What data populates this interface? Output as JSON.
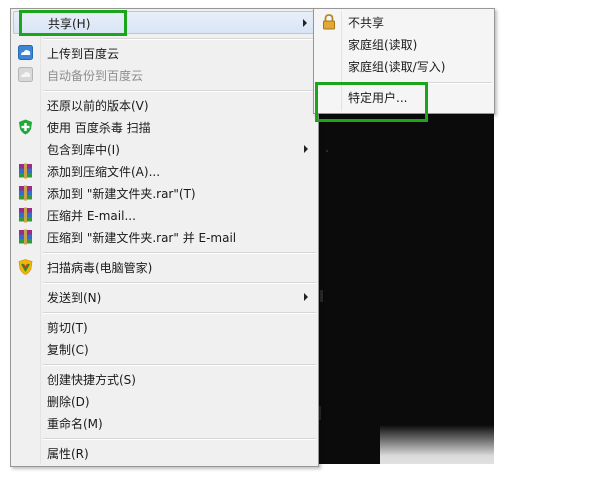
{
  "main_menu": {
    "items": [
      {
        "label": "共享(H)",
        "icon": "share-icon",
        "submenu": true,
        "hover": true
      },
      {
        "label": "上传到百度云",
        "icon": "cloud-upload-icon"
      },
      {
        "label": "自动备份到百度云",
        "icon": "cloud-backup-icon",
        "disabled": true
      },
      {
        "label": "还原以前的版本(V)",
        "icon": ""
      },
      {
        "label": "使用 百度杀毒 扫描",
        "icon": "shield-plus-icon"
      },
      {
        "label": "包含到库中(I)",
        "icon": "",
        "submenu": true
      },
      {
        "label": "添加到压缩文件(A)...",
        "icon": "winrar-icon"
      },
      {
        "label": "添加到 \"新建文件夹.rar\"(T)",
        "icon": "winrar-icon"
      },
      {
        "label": "压缩并 E-mail...",
        "icon": "winrar-icon"
      },
      {
        "label": "压缩到 \"新建文件夹.rar\" 并 E-mail",
        "icon": "winrar-icon"
      },
      {
        "label": "扫描病毒(电脑管家)",
        "icon": "tencent-shield-icon"
      },
      {
        "label": "发送到(N)",
        "icon": "",
        "submenu": true
      },
      {
        "label": "剪切(T)",
        "icon": ""
      },
      {
        "label": "复制(C)",
        "icon": ""
      },
      {
        "label": "创建快捷方式(S)",
        "icon": ""
      },
      {
        "label": "删除(D)",
        "icon": ""
      },
      {
        "label": "重命名(M)",
        "icon": ""
      },
      {
        "label": "属性(R)",
        "icon": ""
      }
    ]
  },
  "sub_menu": {
    "items": [
      {
        "label": "不共享",
        "icon": "lock-icon"
      },
      {
        "label": "家庭组(读取)",
        "icon": ""
      },
      {
        "label": "家庭组(读取/写入)",
        "icon": ""
      },
      {
        "label": "特定用户...",
        "icon": "",
        "hover": true
      }
    ]
  },
  "colors": {
    "menu_bg": "#f0f0f0",
    "highlight_box": "#1aa51a",
    "hover_bg": "#dce7f6",
    "disabled_text": "#8d8d8d"
  }
}
